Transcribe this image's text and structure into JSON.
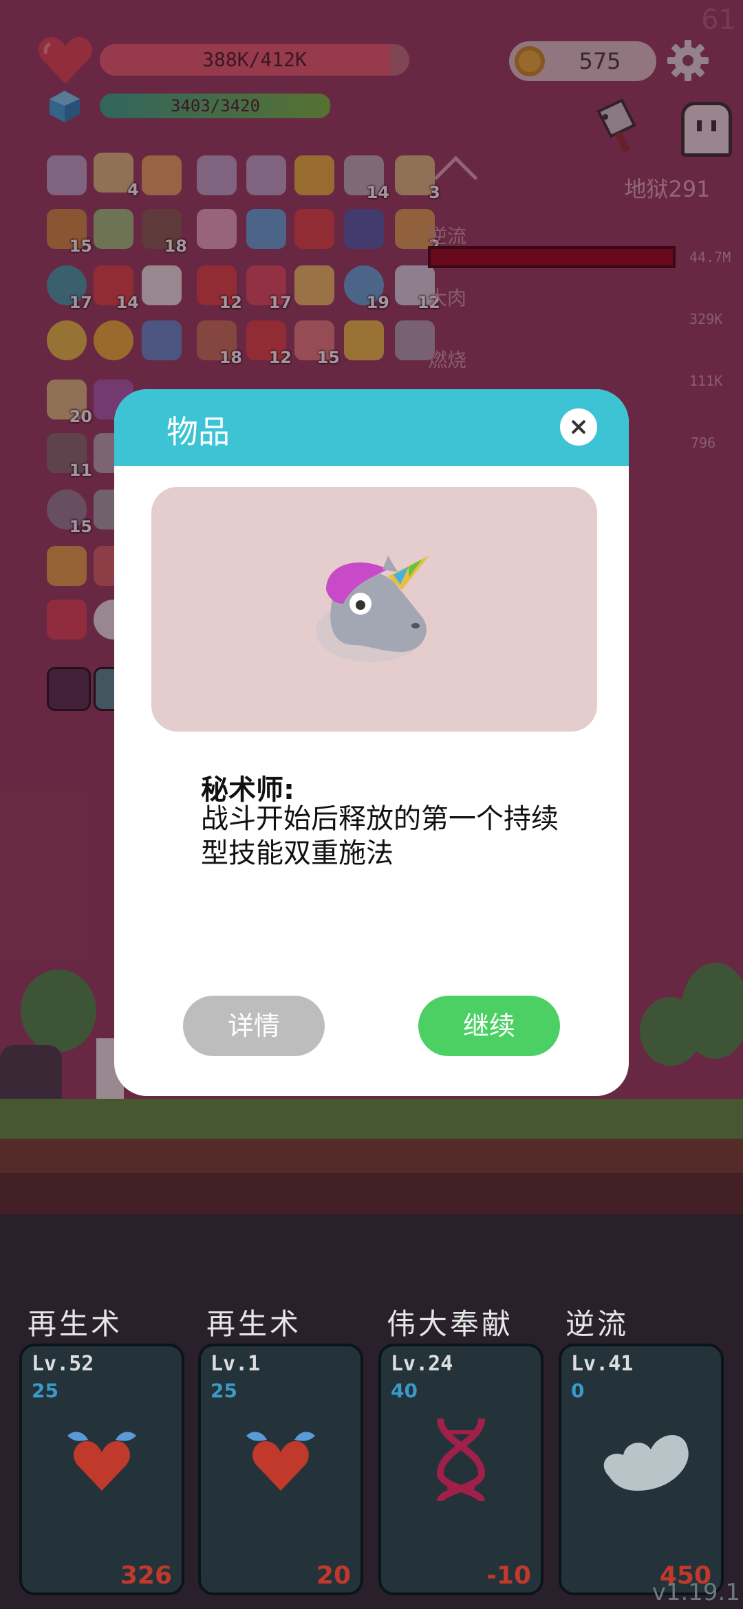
{
  "fps": "61",
  "hud": {
    "hp_text": "388K/412K",
    "hp_fraction": 0.94,
    "mp_text": "3403/3420",
    "mp_fraction": 0.995,
    "coins": "575",
    "level_label": "地狱291",
    "hp_color": "#e05a6a",
    "coin_color": "#e2b030"
  },
  "inventory_counts": [
    "4",
    "14",
    "3",
    "15",
    "18",
    "2",
    "17",
    "14",
    "12",
    "17",
    "19",
    "12",
    "18",
    "12",
    "15",
    "20",
    "11",
    "15"
  ],
  "stats": [
    {
      "label": "逆流",
      "value": "44.7M"
    },
    {
      "label": "大肉",
      "value": "329K"
    },
    {
      "label": "燃烧",
      "value": "111K"
    },
    {
      "label": "",
      "value": "796"
    }
  ],
  "dialog": {
    "title": "物品",
    "item_name": "秘术师:",
    "item_desc": "战斗开始后释放的第一个持续型技能双重施法",
    "detail_label": "详情",
    "continue_label": "继续",
    "header_color": "#3cc4d4",
    "continue_color": "#4cd064"
  },
  "skills": [
    {
      "name": "再生术",
      "level": "Lv.52",
      "cost": "25",
      "value": "326",
      "icon": "winged-heart-icon"
    },
    {
      "name": "再生术",
      "level": "Lv.1",
      "cost": "25",
      "value": "20",
      "icon": "winged-heart-icon"
    },
    {
      "name": "伟大奉献",
      "level": "Lv.24",
      "cost": "40",
      "value": "-10",
      "icon": "dna-icon"
    },
    {
      "name": "逆流",
      "level": "Lv.41",
      "cost": "0",
      "value": "450",
      "icon": "cloud-wing-icon"
    }
  ],
  "version": "v1.19.1"
}
